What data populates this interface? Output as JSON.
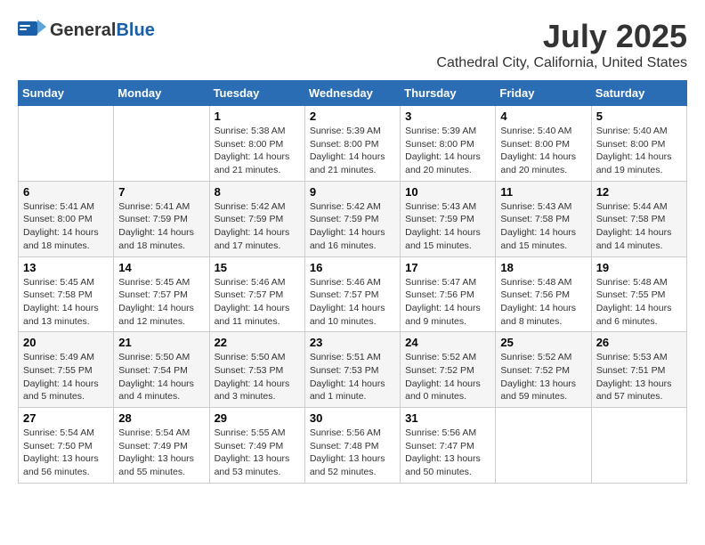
{
  "header": {
    "logo_general": "General",
    "logo_blue": "Blue",
    "month_year": "July 2025",
    "location": "Cathedral City, California, United States"
  },
  "calendar": {
    "days_of_week": [
      "Sunday",
      "Monday",
      "Tuesday",
      "Wednesday",
      "Thursday",
      "Friday",
      "Saturday"
    ],
    "weeks": [
      [
        {
          "day": "",
          "info": ""
        },
        {
          "day": "",
          "info": ""
        },
        {
          "day": "1",
          "info": "Sunrise: 5:38 AM\nSunset: 8:00 PM\nDaylight: 14 hours and 21 minutes."
        },
        {
          "day": "2",
          "info": "Sunrise: 5:39 AM\nSunset: 8:00 PM\nDaylight: 14 hours and 21 minutes."
        },
        {
          "day": "3",
          "info": "Sunrise: 5:39 AM\nSunset: 8:00 PM\nDaylight: 14 hours and 20 minutes."
        },
        {
          "day": "4",
          "info": "Sunrise: 5:40 AM\nSunset: 8:00 PM\nDaylight: 14 hours and 20 minutes."
        },
        {
          "day": "5",
          "info": "Sunrise: 5:40 AM\nSunset: 8:00 PM\nDaylight: 14 hours and 19 minutes."
        }
      ],
      [
        {
          "day": "6",
          "info": "Sunrise: 5:41 AM\nSunset: 8:00 PM\nDaylight: 14 hours and 18 minutes."
        },
        {
          "day": "7",
          "info": "Sunrise: 5:41 AM\nSunset: 7:59 PM\nDaylight: 14 hours and 18 minutes."
        },
        {
          "day": "8",
          "info": "Sunrise: 5:42 AM\nSunset: 7:59 PM\nDaylight: 14 hours and 17 minutes."
        },
        {
          "day": "9",
          "info": "Sunrise: 5:42 AM\nSunset: 7:59 PM\nDaylight: 14 hours and 16 minutes."
        },
        {
          "day": "10",
          "info": "Sunrise: 5:43 AM\nSunset: 7:59 PM\nDaylight: 14 hours and 15 minutes."
        },
        {
          "day": "11",
          "info": "Sunrise: 5:43 AM\nSunset: 7:58 PM\nDaylight: 14 hours and 15 minutes."
        },
        {
          "day": "12",
          "info": "Sunrise: 5:44 AM\nSunset: 7:58 PM\nDaylight: 14 hours and 14 minutes."
        }
      ],
      [
        {
          "day": "13",
          "info": "Sunrise: 5:45 AM\nSunset: 7:58 PM\nDaylight: 14 hours and 13 minutes."
        },
        {
          "day": "14",
          "info": "Sunrise: 5:45 AM\nSunset: 7:57 PM\nDaylight: 14 hours and 12 minutes."
        },
        {
          "day": "15",
          "info": "Sunrise: 5:46 AM\nSunset: 7:57 PM\nDaylight: 14 hours and 11 minutes."
        },
        {
          "day": "16",
          "info": "Sunrise: 5:46 AM\nSunset: 7:57 PM\nDaylight: 14 hours and 10 minutes."
        },
        {
          "day": "17",
          "info": "Sunrise: 5:47 AM\nSunset: 7:56 PM\nDaylight: 14 hours and 9 minutes."
        },
        {
          "day": "18",
          "info": "Sunrise: 5:48 AM\nSunset: 7:56 PM\nDaylight: 14 hours and 8 minutes."
        },
        {
          "day": "19",
          "info": "Sunrise: 5:48 AM\nSunset: 7:55 PM\nDaylight: 14 hours and 6 minutes."
        }
      ],
      [
        {
          "day": "20",
          "info": "Sunrise: 5:49 AM\nSunset: 7:55 PM\nDaylight: 14 hours and 5 minutes."
        },
        {
          "day": "21",
          "info": "Sunrise: 5:50 AM\nSunset: 7:54 PM\nDaylight: 14 hours and 4 minutes."
        },
        {
          "day": "22",
          "info": "Sunrise: 5:50 AM\nSunset: 7:53 PM\nDaylight: 14 hours and 3 minutes."
        },
        {
          "day": "23",
          "info": "Sunrise: 5:51 AM\nSunset: 7:53 PM\nDaylight: 14 hours and 1 minute."
        },
        {
          "day": "24",
          "info": "Sunrise: 5:52 AM\nSunset: 7:52 PM\nDaylight: 14 hours and 0 minutes."
        },
        {
          "day": "25",
          "info": "Sunrise: 5:52 AM\nSunset: 7:52 PM\nDaylight: 13 hours and 59 minutes."
        },
        {
          "day": "26",
          "info": "Sunrise: 5:53 AM\nSunset: 7:51 PM\nDaylight: 13 hours and 57 minutes."
        }
      ],
      [
        {
          "day": "27",
          "info": "Sunrise: 5:54 AM\nSunset: 7:50 PM\nDaylight: 13 hours and 56 minutes."
        },
        {
          "day": "28",
          "info": "Sunrise: 5:54 AM\nSunset: 7:49 PM\nDaylight: 13 hours and 55 minutes."
        },
        {
          "day": "29",
          "info": "Sunrise: 5:55 AM\nSunset: 7:49 PM\nDaylight: 13 hours and 53 minutes."
        },
        {
          "day": "30",
          "info": "Sunrise: 5:56 AM\nSunset: 7:48 PM\nDaylight: 13 hours and 52 minutes."
        },
        {
          "day": "31",
          "info": "Sunrise: 5:56 AM\nSunset: 7:47 PM\nDaylight: 13 hours and 50 minutes."
        },
        {
          "day": "",
          "info": ""
        },
        {
          "day": "",
          "info": ""
        }
      ]
    ]
  }
}
